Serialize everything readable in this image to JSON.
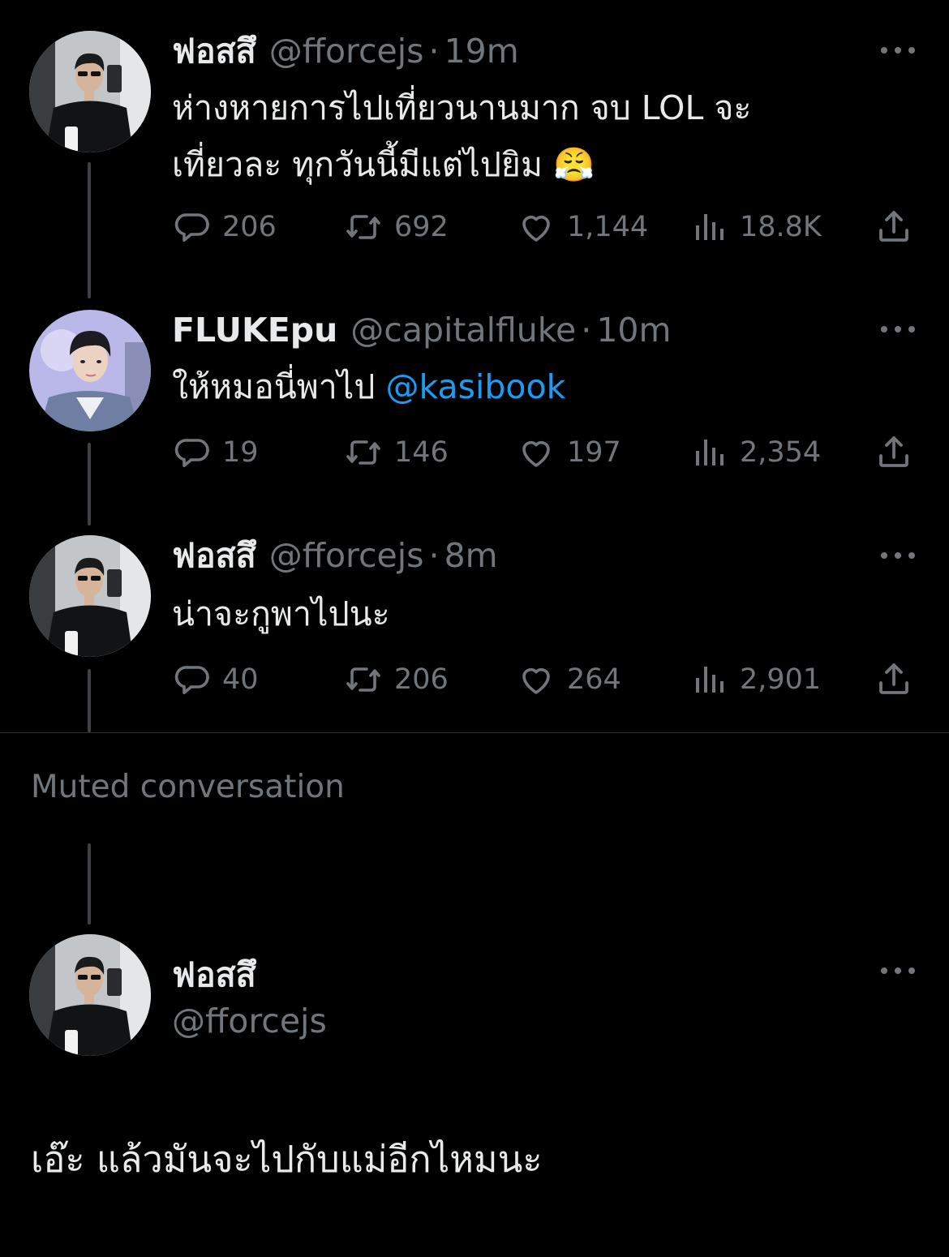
{
  "tweets": [
    {
      "name": "ฟอสสึ",
      "handle": "@fforcejs",
      "separator": "·",
      "time": "19m",
      "text_lines": [
        "ห่างหายการไปเที่ยวนานมาก จบ LOL จะ",
        "เที่ยวละ ทุกวันนี้มีแต่ไปยิม"
      ],
      "emoji": "😤",
      "stats": {
        "replies": "206",
        "retweets": "692",
        "likes": "1,144",
        "views": "18.8K"
      }
    },
    {
      "name": "FLUKEpu",
      "handle": "@capitalfluke",
      "separator": "·",
      "time": "10m",
      "text": "ให้หมอนี่พาไป",
      "mention": "@kasibook",
      "stats": {
        "replies": "19",
        "retweets": "146",
        "likes": "197",
        "views": "2,354"
      }
    },
    {
      "name": "ฟอสสึ",
      "handle": "@fforcejs",
      "separator": "·",
      "time": "8m",
      "text": "น่าจะกูพาไปนะ",
      "stats": {
        "replies": "40",
        "retweets": "206",
        "likes": "264",
        "views": "2,901"
      }
    }
  ],
  "muted_label": "Muted conversation",
  "final_tweet": {
    "name": "ฟอสสึ",
    "handle": "@fforcejs",
    "text": "เอ๊ะ แล้วมันจะไปกับแม่อีกไหมนะ"
  },
  "icons": {
    "reply": "speech-bubble-icon",
    "retweet": "retweet-arrows-icon",
    "like": "heart-icon",
    "views": "bar-chart-icon",
    "share": "share-upload-icon",
    "more": "ellipsis-icon"
  },
  "colors": {
    "background": "#000000",
    "text": "#e7e9ea",
    "secondary": "#71767b",
    "link": "#1d9bf0",
    "thread_line": "#3e4144",
    "divider": "#2f3336"
  }
}
